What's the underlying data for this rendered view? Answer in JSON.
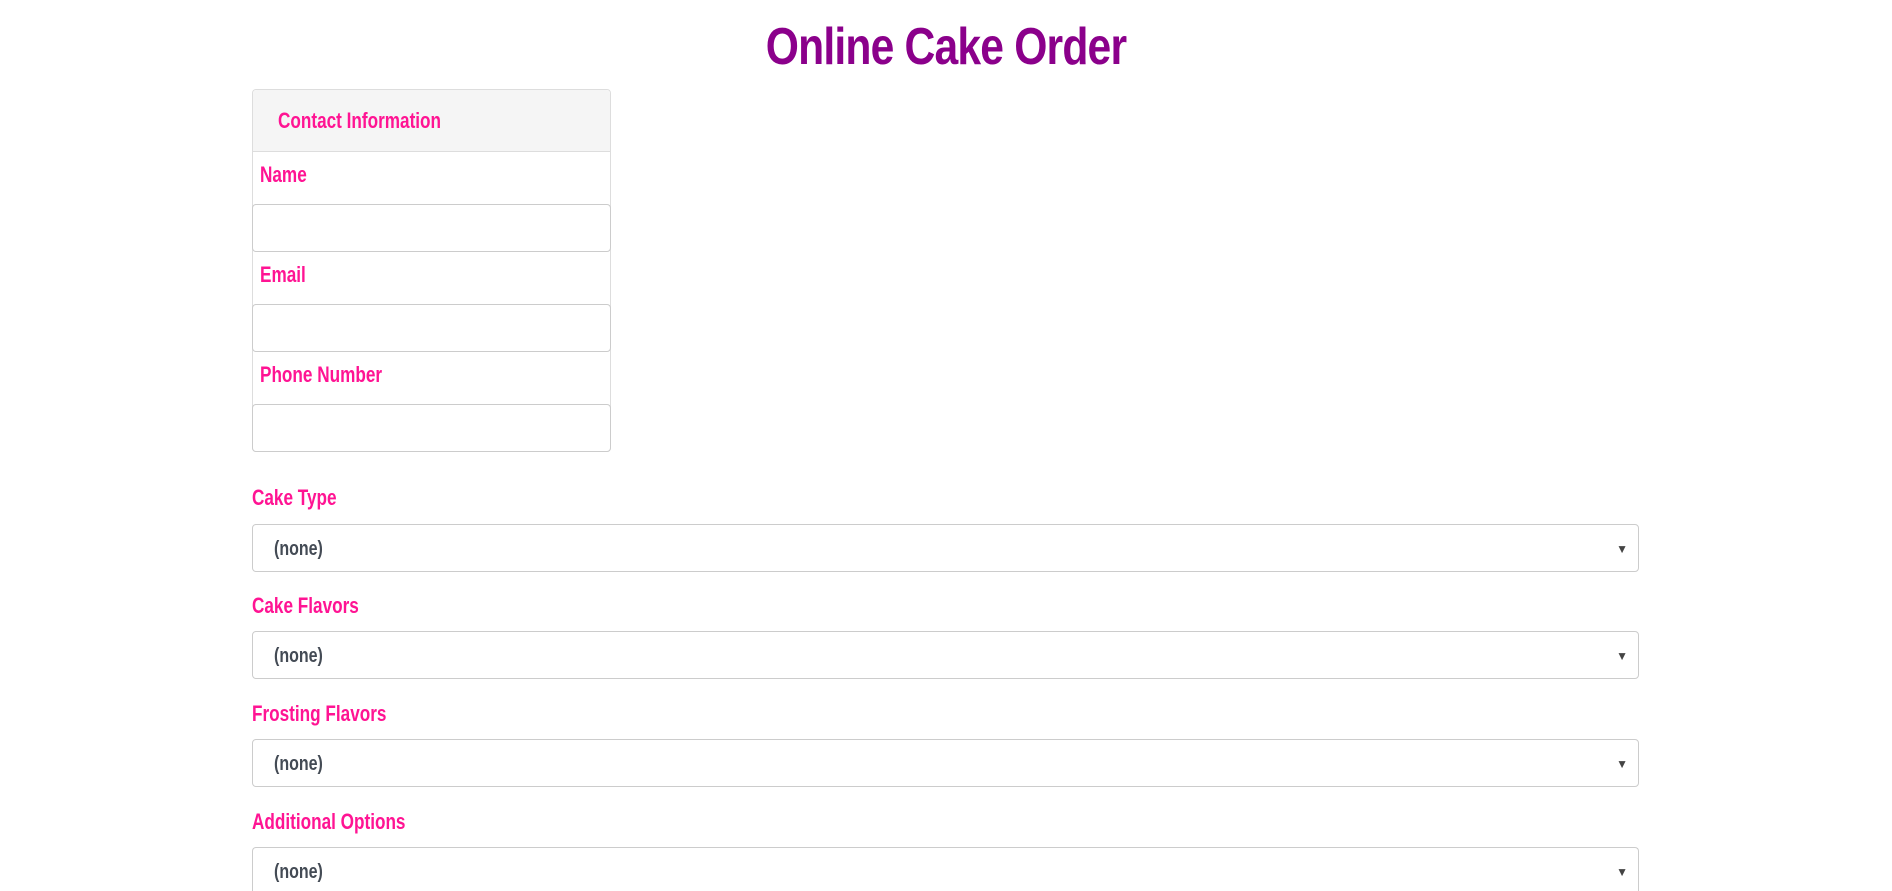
{
  "header": {
    "title": "Online Cake Order"
  },
  "contact": {
    "heading": "Contact Information",
    "fields": [
      {
        "label": "Name",
        "value": "",
        "placeholder": ""
      },
      {
        "label": "Email",
        "value": "",
        "placeholder": ""
      },
      {
        "label": "Phone Number",
        "value": "",
        "placeholder": ""
      }
    ]
  },
  "selects": [
    {
      "label": "Cake Type",
      "value": "(none)"
    },
    {
      "label": "Cake Flavors",
      "value": "(none)"
    },
    {
      "label": "Frosting Flavors",
      "value": "(none)"
    },
    {
      "label": "Additional Options",
      "value": "(none)"
    }
  ],
  "icons": {
    "select_caret": "caret-down-icon"
  },
  "colors": {
    "title": "#8b008b",
    "label": "#ff1493",
    "select_text": "#444b55",
    "panel_heading_bg": "#f5f5f5",
    "border": "#cccccc"
  }
}
